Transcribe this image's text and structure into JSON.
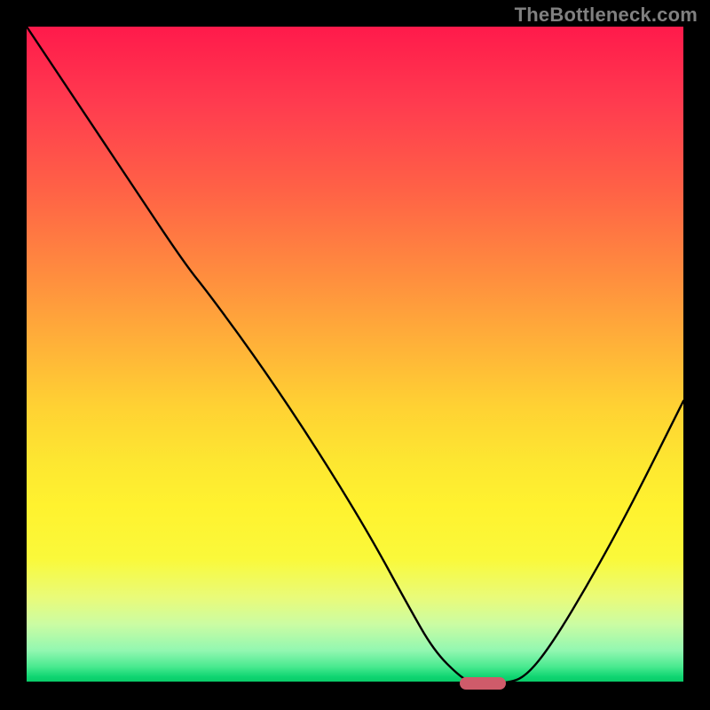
{
  "watermark": "TheBottleneck.com",
  "chart_data": {
    "type": "line",
    "title": "",
    "xlabel": "",
    "ylabel": "",
    "xlim": [
      0,
      100
    ],
    "ylim": [
      0,
      100
    ],
    "grid": false,
    "series": [
      {
        "name": "bottleneck-curve",
        "x": [
          0,
          8,
          16,
          24,
          28,
          36,
          44,
          52,
          58,
          62,
          66,
          68,
          73,
          76,
          80,
          86,
          92,
          100
        ],
        "y": [
          100,
          88,
          76,
          64,
          59,
          48,
          36,
          23,
          12,
          5,
          1,
          0,
          0,
          1,
          6,
          16,
          27,
          43
        ]
      }
    ],
    "optimal_zone": {
      "x_start": 66,
      "x_end": 73,
      "y": 0
    },
    "gradient": {
      "top_color": "#ff1a4b",
      "mid_color": "#ffd233",
      "bottom_color": "#07c766"
    }
  }
}
